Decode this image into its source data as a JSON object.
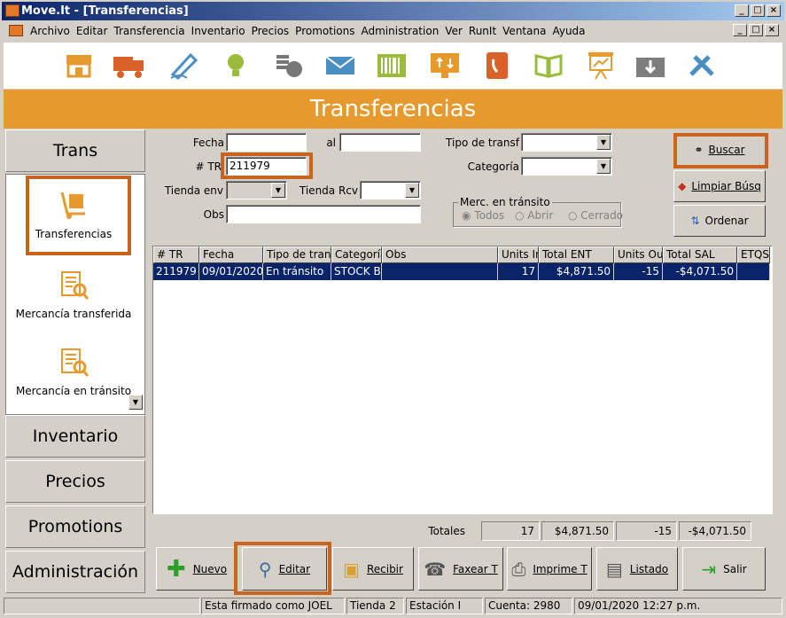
{
  "window": {
    "title": "Move.It - [Transferencias]",
    "min": "_",
    "max": "□",
    "close": "×",
    "restore": "ꟷ"
  },
  "menu": [
    "Archivo",
    "Editar",
    "Transferencia",
    "Inventario",
    "Precios",
    "Promotions",
    "Administration",
    "Ver",
    "RunIt",
    "Ventana",
    "Ayuda"
  ],
  "toolbar_icons": [
    "store-icon",
    "truck-icon",
    "pen-icon",
    "lightbulb-icon",
    "coins-icon",
    "envelope-icon",
    "barcode-icon",
    "monitor-exchange-icon",
    "phone-icon",
    "book-icon",
    "presentation-icon",
    "download-box-icon",
    "tools-icon"
  ],
  "banner": "Transferencias",
  "nav": {
    "trans": "Trans",
    "items": [
      "Transferencias",
      "Mercancía transferida",
      "Mercancía en tránsito"
    ],
    "inventario": "Inventario",
    "precios": "Precios",
    "promotions": "Promotions",
    "administracion": "Administración"
  },
  "form": {
    "fecha_label": "Fecha",
    "al_label": "al",
    "tr_label": "# TR",
    "tr_value": "211979",
    "tienda_env_label": "Tienda env",
    "tienda_rcv_label": "Tienda Rcv",
    "obs_label": "Obs",
    "tipo_label": "Tipo de transf",
    "categoria_label": "Categoría",
    "merc_group": "Merc. en tránsito",
    "radio_todos": "Todos",
    "radio_abrir": "Abrir",
    "radio_cerrado": "Cerrado"
  },
  "buttons": {
    "buscar": "Buscar",
    "limpiar": "Limpiar Búsq",
    "ordenar": "Ordenar"
  },
  "grid": {
    "headers": [
      "# TR",
      "Fecha",
      "Tipo de transf",
      "Categoría",
      "Obs",
      "Units In",
      "Total ENT",
      "Units Out",
      "Total SAL",
      "ETQS"
    ],
    "rows": [
      [
        "211979",
        "09/01/2020",
        "En tránsito",
        "STOCK BA",
        "",
        "17",
        "$4,871.50",
        "-15",
        "-$4,071.50",
        ""
      ]
    ]
  },
  "totals": {
    "label": "Totales",
    "units_in": "17",
    "total_ent": "$4,871.50",
    "units_out": "-15",
    "total_sal": "-$4,071.50"
  },
  "bottom": {
    "nuevo": "Nuevo",
    "editar": "Editar",
    "recibir": "Recibir",
    "faxear": "Faxear T",
    "imprime": "Imprime T",
    "listado": "Listado",
    "salir": "Salir"
  },
  "status": {
    "user": "Esta firmado como JOEL",
    "tienda": "Tienda 2",
    "estacion": "Estación I",
    "cuenta": "Cuenta: 2980",
    "fecha": "09/01/2020 12:27 p.m."
  }
}
